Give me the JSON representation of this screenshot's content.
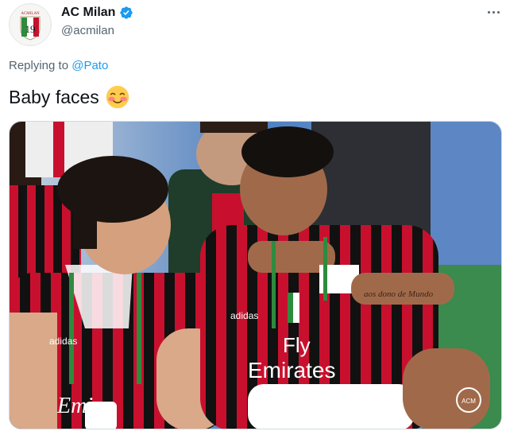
{
  "author": {
    "display_name": "AC Milan",
    "handle": "@acmilan",
    "verified": true,
    "avatar_badge_text": "ACMILAN",
    "avatar_badge_number": "19"
  },
  "reply": {
    "prefix": "Replying to",
    "mention": "@Pato"
  },
  "tweet": {
    "text": "Baby faces",
    "emoji": "smiling-face-with-blush"
  },
  "media": {
    "shirt_sponsor_left": "Emira",
    "shirt_sponsor_right_1": "Fly",
    "shirt_sponsor_right_2": "Emirates",
    "kit_brand": "adidas",
    "arm_tattoo": "aos dono de Mundo",
    "photo_corner_logo": "ACM"
  },
  "colors": {
    "verified_blue": "#1d9bf0",
    "link_blue": "#1d9bf0",
    "secondary_text": "#536471",
    "milan_red": "#c8102e",
    "milan_black": "#111111"
  },
  "icons": [
    "verified-badge-icon",
    "more-options-icon",
    "smiling-face-with-blush-icon"
  ]
}
